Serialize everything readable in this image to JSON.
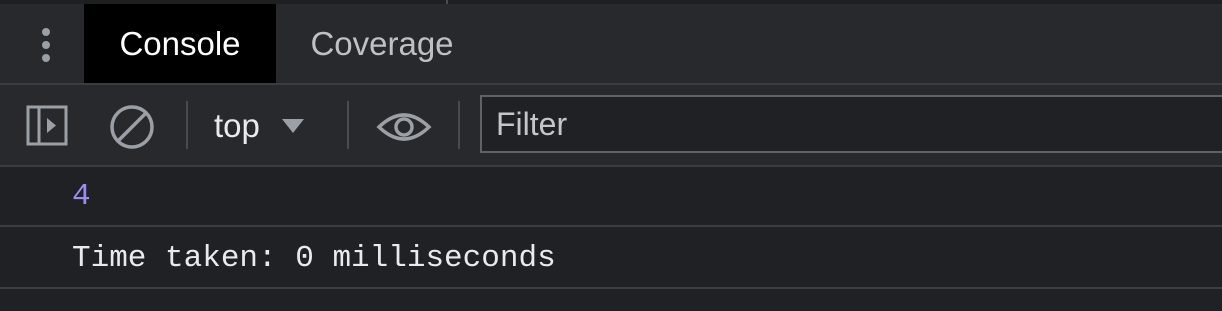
{
  "tabs": {
    "menu_icon": "vertical-ellipsis-icon",
    "console": "Console",
    "coverage": "Coverage"
  },
  "toolbar": {
    "sidebar_icon": "show-sidebar-icon",
    "clear_icon": "clear-console-icon",
    "context": "top",
    "eye_icon": "live-expression-eye-icon",
    "filter_placeholder": "Filter"
  },
  "console": {
    "messages": [
      {
        "text": "4",
        "kind": "number",
        "color": "#9d8cf0"
      },
      {
        "text": "Time taken: 0 milliseconds",
        "kind": "log",
        "color": "#e8eaed"
      }
    ]
  }
}
